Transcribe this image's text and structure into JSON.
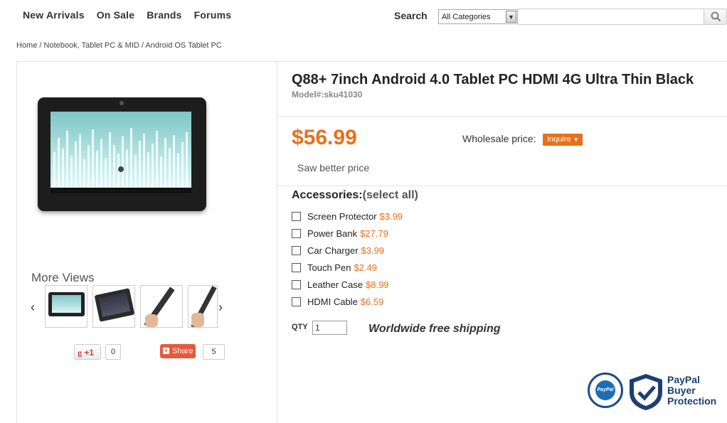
{
  "nav": {
    "items": [
      {
        "label": "New Arrivals"
      },
      {
        "label": "On Sale"
      },
      {
        "label": "Brands"
      },
      {
        "label": "Forums"
      }
    ]
  },
  "search": {
    "label": "Search",
    "category_selected": "All Categories",
    "query": ""
  },
  "breadcrumb": {
    "items": [
      "Home",
      "Notebook, Tablet PC & MID",
      "Android OS Tablet PC"
    ],
    "separator": " / "
  },
  "gallery": {
    "more_views_label": "More Views",
    "thumbnail_count_visible": 4
  },
  "social": {
    "gplus_label": "+1",
    "gplus_count": "0",
    "share_label": "Share",
    "share_count": "5"
  },
  "product": {
    "title": "Q88+ 7inch Android 4.0 Tablet PC HDMI 4G Ultra Thin Black",
    "model": "Model#:sku41030",
    "price": "$56.99",
    "wholesale_label": "Wholesale price:",
    "inquire_label": "Inquire",
    "saw_better_price": "Saw better price"
  },
  "accessories": {
    "title": "Accessories:",
    "select_all": "(select all)",
    "items": [
      {
        "name": "Screen Protector",
        "price": "$3.99"
      },
      {
        "name": "Power Bank",
        "price": "$27.79"
      },
      {
        "name": "Car Charger",
        "price": "$3.99"
      },
      {
        "name": "Touch Pen",
        "price": "$2.49"
      },
      {
        "name": "Leather Case",
        "price": "$8.99"
      },
      {
        "name": "HDMI Cable",
        "price": "$6.59"
      }
    ]
  },
  "purchase": {
    "qty_label": "QTY",
    "qty_value": "1",
    "shipping_text": "Worldwide free shipping"
  },
  "badge": {
    "seal_text": "PayPal",
    "line1": "PayPal",
    "line2": "Buyer",
    "line3": "Protection"
  },
  "colors": {
    "price_orange": "#e8701a",
    "paypal_blue": "#1d3f72"
  }
}
